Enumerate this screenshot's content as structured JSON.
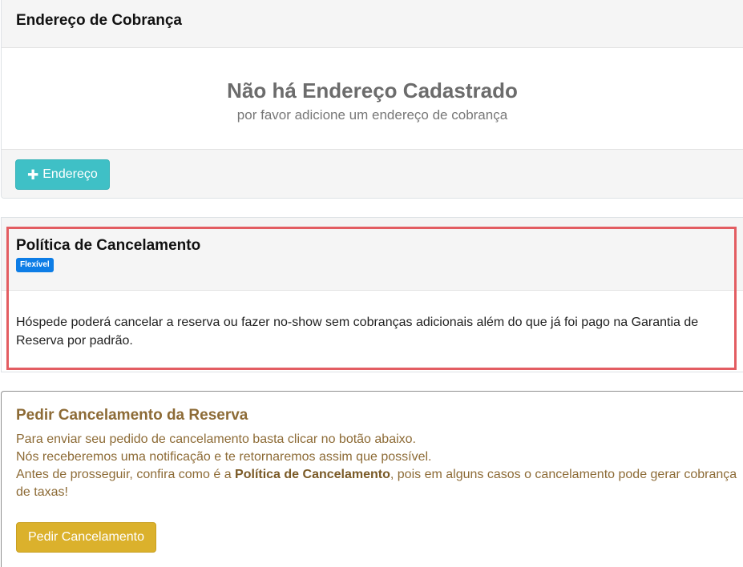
{
  "address": {
    "title": "Endereço de Cobrança",
    "empty_title": "Não há Endereço Cadastrado",
    "empty_subtitle": "por favor adicione um endereço de cobrança",
    "add_button_label": "Endereço"
  },
  "policy": {
    "title": "Política de Cancelamento",
    "badge": "Flexível",
    "description": "Hóspede poderá cancelar a reserva ou fazer no-show sem cobranças adicionais além do que já foi pago na Garantia de Reserva por padrão."
  },
  "cancel": {
    "title": "Pedir Cancelamento da Reserva",
    "line1": "Para enviar seu pedido de cancelamento basta clicar no botão abaixo.",
    "line2": "Nós receberemos uma notificação e te retornaremos assim que possível.",
    "line3_before": "Antes de prosseguir, confira como é a ",
    "line3_bold": "Política de Cancelamento",
    "line3_after": ", pois em alguns casos o cancelamento pode gerar cobrança de taxas!",
    "button_label": "Pedir Cancelamento"
  },
  "colors": {
    "info_button": "#3fc0c6",
    "badge": "#0d7de6",
    "highlight_border": "#e35d62",
    "warning_text": "#8d6b36",
    "warning_button": "#dbb12c"
  },
  "icons": {
    "add_button_icon": "plus-icon"
  }
}
